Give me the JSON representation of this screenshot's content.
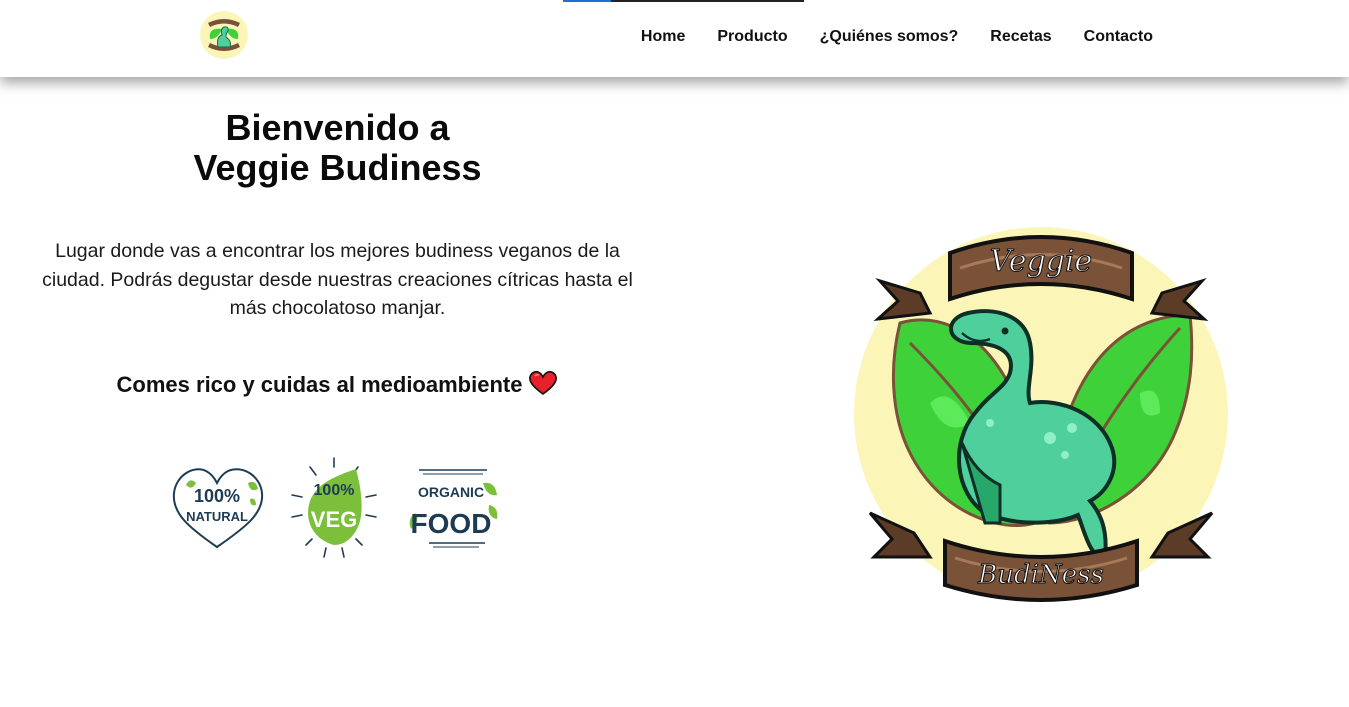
{
  "nav": {
    "logo_icon": "veggie-budiness-logo",
    "links": [
      "Home",
      "Producto",
      "¿Quiénes somos?",
      "Recetas",
      "Contacto"
    ]
  },
  "hero": {
    "title_line1": "Bienvenido a",
    "title_line2": "Veggie Budiness",
    "description": "Lugar donde vas a encontrar los mejores budiness veganos de la ciudad. Podrás degustar desde nuestras creaciones cítricas hasta el más chocolatoso manjar.",
    "tagline": "Comes rico y cuidas al medioambiente",
    "tagline_icon": "heart-icon"
  },
  "badges": [
    {
      "icon": "natural-badge-icon",
      "line1": "100%",
      "line2": "NATURAL"
    },
    {
      "icon": "veg-badge-icon",
      "line1": "100%",
      "line2": "VEG"
    },
    {
      "icon": "organic-badge-icon",
      "line1": "ORGANIC",
      "line2": "FOOD"
    }
  ],
  "logo": {
    "top_text": "Veggie",
    "bottom_text": "BudiNess"
  },
  "colors": {
    "leaf_green": "#3fd13a",
    "dino_teal": "#4fcf9c",
    "badge_green": "#7cbf3a",
    "badge_navy": "#1d3c54",
    "ribbon_brown": "#7a5238",
    "circle_cream": "#fbf6b8"
  }
}
